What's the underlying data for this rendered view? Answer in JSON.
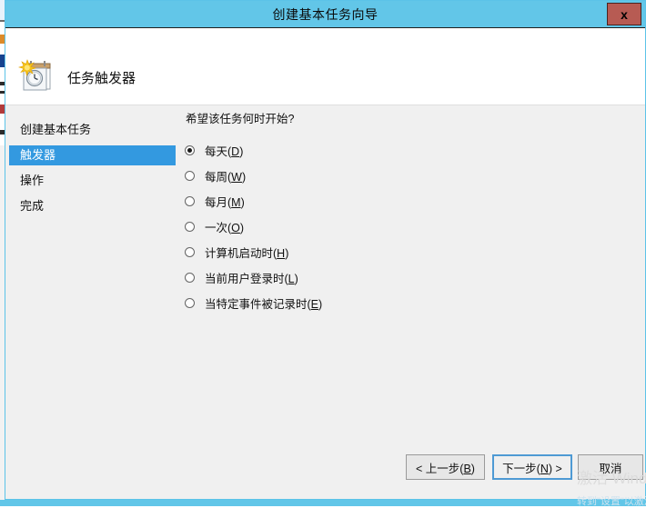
{
  "window": {
    "title": "创建基本任务向导",
    "close_label": "x"
  },
  "header": {
    "icon": "task-scheduler-clock-calendar-icon",
    "title": "任务触发器"
  },
  "sidebar": {
    "items": [
      {
        "label": "创建基本任务",
        "selected": false
      },
      {
        "label": "触发器",
        "selected": true
      },
      {
        "label": "操作",
        "selected": false
      },
      {
        "label": "完成",
        "selected": false
      }
    ]
  },
  "main": {
    "question": "希望该任务何时开始?",
    "options": [
      {
        "text": "每天(",
        "accel": "D",
        "tail": ")",
        "checked": true
      },
      {
        "text": "每周(",
        "accel": "W",
        "tail": ")",
        "checked": false
      },
      {
        "text": "每月(",
        "accel": "M",
        "tail": ")",
        "checked": false
      },
      {
        "text": "一次(",
        "accel": "O",
        "tail": ")",
        "checked": false
      },
      {
        "text": "计算机启动时(",
        "accel": "H",
        "tail": ")",
        "checked": false
      },
      {
        "text": "当前用户登录时(",
        "accel": "L",
        "tail": ")",
        "checked": false
      },
      {
        "text": "当特定事件被记录时(",
        "accel": "E",
        "tail": ")",
        "checked": false
      }
    ]
  },
  "footer": {
    "back": {
      "pre": "< 上一步(",
      "accel": "B",
      "post": ")"
    },
    "next": {
      "pre": "下一步(",
      "accel": "N",
      "post": ") >"
    },
    "cancel": {
      "pre": "取消",
      "accel": "",
      "post": ""
    }
  },
  "watermark": {
    "line1": "激活 Windows",
    "line2": "转到\"设置\"以激活 Windows。"
  },
  "colors": {
    "titlebar": "#62c6e8",
    "accent_selection": "#3399e0",
    "close_button": "#b75b53",
    "dialog_face": "#f0f0f0"
  }
}
